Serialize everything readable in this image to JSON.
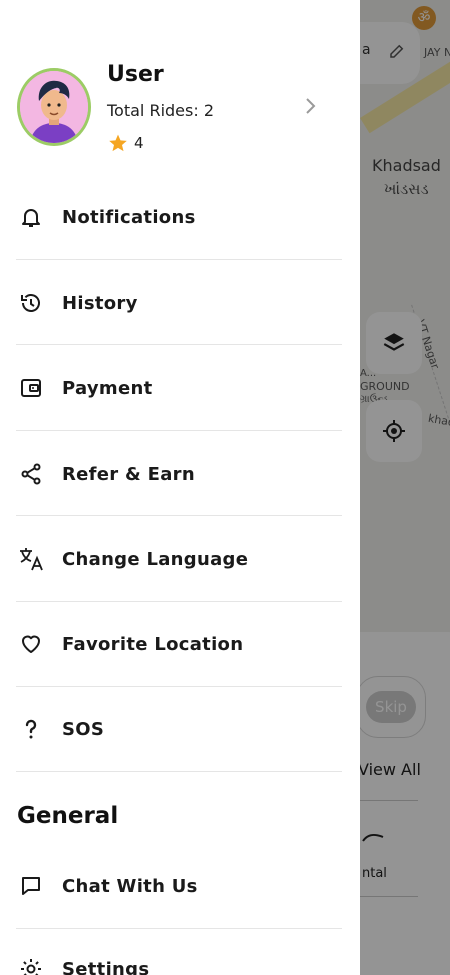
{
  "map": {
    "search_label": "a",
    "area_top_label": "JAY N",
    "place_name": "Khadsad",
    "place_name_local": "ખાંડસડ",
    "road_label": "VT Nagar",
    "ground_label": "GROUND",
    "ground_prefix": "A...",
    "ground_local": "ગ્રાઉન્ડ",
    "street_label": "khad",
    "skip_button": "Skip",
    "view_all_link": "View All",
    "service_label": "ntal"
  },
  "profile": {
    "name": "User",
    "total_rides": "Total Rides: 2",
    "rating": "4"
  },
  "menu": [
    {
      "label": "Notifications",
      "icon": "bell-icon"
    },
    {
      "label": "History",
      "icon": "history-icon"
    },
    {
      "label": "Payment",
      "icon": "wallet-icon"
    },
    {
      "label": "Refer & Earn",
      "icon": "share-icon"
    },
    {
      "label": "Change Language",
      "icon": "translate-icon"
    },
    {
      "label": "Favorite Location",
      "icon": "heart-icon"
    },
    {
      "label": "SOS",
      "icon": "question-icon"
    }
  ],
  "general": {
    "title": "General",
    "items": [
      {
        "label": "Chat With Us",
        "icon": "chat-icon"
      },
      {
        "label": "Settings",
        "icon": "gear-icon"
      }
    ]
  },
  "colors": {
    "star": "#f5a623",
    "avatar_ring": "#9ccc65",
    "avatar_bg": "#f3b7e2"
  }
}
